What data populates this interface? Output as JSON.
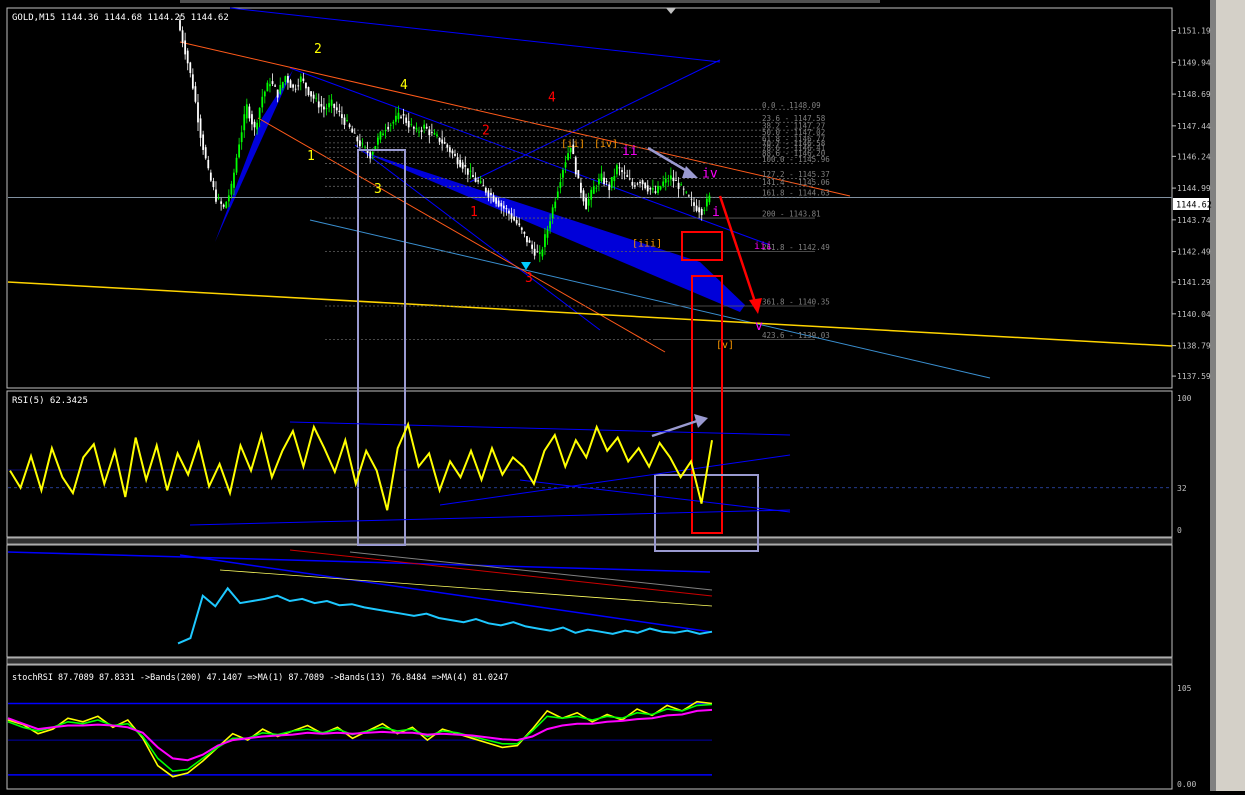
{
  "colors": {
    "background": "#000000",
    "frame": "#c0c0c0",
    "candle_up": "#00ff00",
    "candle_down": "#ffffff",
    "rsi_line": "#ffff00",
    "blue_line": "#0000ff",
    "accent_red": "#ff0000",
    "fib_text": "#808080",
    "macd_line": "#1ec8ff",
    "stoch_magenta": "#ff00ff",
    "stoch_green": "#00ff00",
    "stoch_yellow": "#ffff00",
    "side_panel": "#d4d0c8"
  },
  "chart_data": [
    {
      "id": "price",
      "type": "candlestick",
      "title": "GOLD,M15  1144.36 1144.68 1144.25 1144.62",
      "current_price_label": "1144.62",
      "ylim": [
        1137.2,
        1152.0
      ],
      "y_ticks": [
        "1151.19",
        "1149.94",
        "1148.69",
        "1147.44",
        "1146.24",
        "1144.99",
        "1143.74",
        "1142.49",
        "1141.29",
        "1140.04",
        "1138.79",
        "1137.59"
      ],
      "close_path": [
        1151.6,
        1150.4,
        1149.0,
        1147.1,
        1145.6,
        1144.6,
        1144.2,
        1145.0,
        1146.8,
        1148.2,
        1147.3,
        1148.6,
        1149.2,
        1148.7,
        1149.4,
        1148.9,
        1149.3,
        1148.8,
        1148.4,
        1148.1,
        1148.3,
        1147.9,
        1147.5,
        1147.0,
        1146.6,
        1146.3,
        1146.9,
        1147.4,
        1147.6,
        1147.9,
        1147.5,
        1147.2,
        1147.4,
        1147.1,
        1146.9,
        1146.6,
        1146.2,
        1145.9,
        1145.5,
        1145.2,
        1144.9,
        1144.6,
        1144.3,
        1144.0,
        1143.6,
        1143.1,
        1142.6,
        1142.3,
        1143.4,
        1144.6,
        1145.8,
        1146.7,
        1145.2,
        1144.3,
        1145.0,
        1145.4,
        1145.0,
        1145.8,
        1145.5,
        1145.1,
        1145.3,
        1145.0,
        1144.8,
        1145.2,
        1145.4,
        1145.1,
        1144.7,
        1144.3,
        1144.1,
        1144.6
      ],
      "fib_levels": [
        {
          "label": "0.0 - 1148.09",
          "value": 1148.09
        },
        {
          "label": "23.6 - 1147.58",
          "value": 1147.58
        },
        {
          "label": "38.2 - 1147.27",
          "value": 1147.27
        },
        {
          "label": "50.0 - 1147.02",
          "value": 1147.02
        },
        {
          "label": "61.8 - 1146.77",
          "value": 1146.77
        },
        {
          "label": "70.7 - 1146.58",
          "value": 1146.58
        },
        {
          "label": "78.6 - 1146.41",
          "value": 1146.41
        },
        {
          "label": "88.6 - 1146.20",
          "value": 1146.2
        },
        {
          "label": "100.0 - 1145.96",
          "value": 1145.96
        },
        {
          "label": "127.2 - 1145.37",
          "value": 1145.37
        },
        {
          "label": "141.4 - 1145.06",
          "value": 1145.06
        },
        {
          "label": "161.8 - 1144.63",
          "value": 1144.63
        },
        {
          "label": "200 - 1143.81",
          "value": 1143.81
        },
        {
          "label": "261.8 - 1142.49",
          "value": 1142.49
        },
        {
          "label": "361.8 - 1140.35",
          "value": 1140.35
        },
        {
          "label": "423.6 - 1139.03",
          "value": 1139.03
        }
      ],
      "wave_labels": [
        {
          "text": "2",
          "color": "#ffff00",
          "value": 1150.3
        },
        {
          "text": "1",
          "color": "#ffff00",
          "value": 1146.1
        },
        {
          "text": "3",
          "color": "#ffff00",
          "value": 1144.8
        },
        {
          "text": "4",
          "color": "#ffff00",
          "value": 1148.9
        },
        {
          "text": "4",
          "color": "#ff0000",
          "value": 1148.4
        },
        {
          "text": "2",
          "color": "#ff0000",
          "value": 1147.1
        },
        {
          "text": "1",
          "color": "#ff0000",
          "value": 1143.9
        },
        {
          "text": "3",
          "color": "#ff0000",
          "value": 1141.3
        },
        {
          "text": "[ii]",
          "color": "#ff9900",
          "value": 1146.6
        },
        {
          "text": "[iv]",
          "color": "#ff9900",
          "value": 1146.6
        },
        {
          "text": "[iii]",
          "color": "#ff9900",
          "value": 1142.7
        },
        {
          "text": "ii",
          "color": "#ff00ff",
          "value": 1146.3
        },
        {
          "text": "i",
          "color": "#ff00ff",
          "value": 1143.9
        },
        {
          "text": "iv",
          "color": "#ff00ff",
          "value": 1145.4
        },
        {
          "text": "iii",
          "color": "#ff00ff",
          "value": 1142.6
        },
        {
          "text": "v",
          "color": "#ff00ff",
          "value": 1139.4
        },
        {
          "text": "[v]",
          "color": "#ff9900",
          "value": 1138.7
        }
      ]
    },
    {
      "id": "rsi",
      "type": "line",
      "title": "RSI(5) 62.3425",
      "ylim": [
        0,
        100
      ],
      "y_ticks": [
        "100",
        "32",
        "0"
      ],
      "series": [
        {
          "values": [
            45,
            32,
            56,
            30,
            62,
            40,
            28,
            55,
            65,
            35,
            60,
            25,
            70,
            38,
            64,
            30,
            58,
            42,
            66,
            33,
            50,
            28,
            64,
            45,
            72,
            40,
            60,
            75,
            48,
            78,
            62,
            44,
            68,
            35,
            60,
            45,
            15,
            62,
            80,
            48,
            58,
            30,
            52,
            40,
            60,
            38,
            62,
            42,
            55,
            48,
            35,
            60,
            72,
            48,
            68,
            55,
            78,
            60,
            70,
            52,
            62,
            48,
            66,
            55,
            40,
            52,
            20,
            68
          ]
        }
      ]
    },
    {
      "id": "macd",
      "type": "line",
      "title": "",
      "series": [
        {
          "values": [
            0.1,
            0.15,
            0.55,
            0.45,
            0.62,
            0.48,
            0.5,
            0.52,
            0.55,
            0.5,
            0.52,
            0.48,
            0.5,
            0.46,
            0.47,
            0.44,
            0.42,
            0.4,
            0.38,
            0.36,
            0.38,
            0.34,
            0.32,
            0.3,
            0.33,
            0.29,
            0.27,
            0.3,
            0.26,
            0.24,
            0.22,
            0.25,
            0.2,
            0.23,
            0.21,
            0.19,
            0.22,
            0.2,
            0.24,
            0.21,
            0.2,
            0.22,
            0.19,
            0.21
          ]
        }
      ]
    },
    {
      "id": "stoch",
      "type": "line",
      "title": "stochRSI 87.7089 87.8331  ->Bands(200) 47.1407  =>MA(1) 87.7089  ->Bands(13) 76.8484  =>MA(4) 81.0247",
      "ylim": [
        0,
        105
      ],
      "y_ticks": [
        "105",
        "0.00"
      ],
      "series": [
        {
          "values": [
            70,
            65,
            55,
            60,
            72,
            68,
            74,
            62,
            70,
            50,
            20,
            8,
            12,
            25,
            40,
            55,
            48,
            60,
            52,
            58,
            64,
            55,
            62,
            50,
            58,
            66,
            55,
            62,
            48,
            60,
            55,
            50,
            45,
            40,
            42,
            60,
            80,
            72,
            78,
            68,
            76,
            70,
            82,
            75,
            86,
            80,
            90,
            88
          ]
        },
        {
          "values": [
            68,
            62,
            58,
            62,
            68,
            66,
            70,
            64,
            66,
            52,
            28,
            14,
            16,
            28,
            40,
            50,
            50,
            56,
            54,
            58,
            60,
            56,
            60,
            54,
            58,
            62,
            58,
            60,
            52,
            58,
            56,
            52,
            48,
            44,
            44,
            58,
            74,
            72,
            74,
            70,
            74,
            72,
            78,
            76,
            82,
            80,
            86,
            87
          ]
        },
        {
          "values": [
            72,
            66,
            60,
            62,
            64,
            64,
            65,
            64,
            62,
            56,
            40,
            28,
            26,
            32,
            42,
            48,
            50,
            52,
            53,
            54,
            56,
            55,
            56,
            55,
            56,
            57,
            56,
            56,
            54,
            55,
            54,
            53,
            51,
            49,
            48,
            52,
            60,
            64,
            66,
            66,
            68,
            69,
            71,
            72,
            75,
            76,
            80,
            81
          ]
        }
      ]
    }
  ]
}
